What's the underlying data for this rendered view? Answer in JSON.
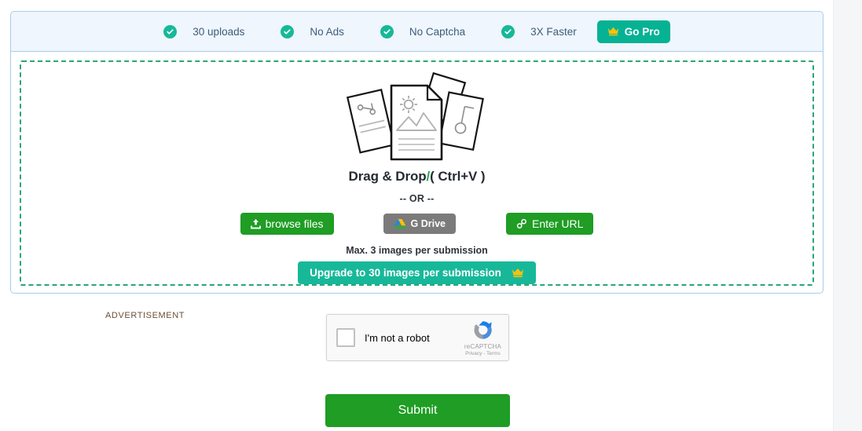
{
  "promo_banner": {
    "features": [
      {
        "icon": "check-circle-icon",
        "label": "30 uploads"
      },
      {
        "icon": "check-circle-icon",
        "label": "No Ads"
      },
      {
        "icon": "check-circle-icon",
        "label": "No Captcha"
      },
      {
        "icon": "check-circle-icon",
        "label": "3X Faster"
      }
    ],
    "go_pro_label": "Go Pro",
    "go_pro_icon": "crown-icon",
    "background_color": "#eff6fd",
    "border_color": "#a8cdec",
    "accent_color": "#06b294",
    "check_color": "#17b899",
    "crown_color": "#f2c310"
  },
  "dropzone": {
    "illustration_icon": "documents-stack-icon",
    "border_color": "#27a776",
    "drag_drop_main": "Drag & Drop",
    "drag_drop_separator": "/",
    "drag_drop_shortcut": "( Ctrl+V )",
    "or_text": "-- OR --",
    "buttons": {
      "browse_label": "browse files",
      "browse_icon": "upload-icon",
      "browse_color": "#1f9d24",
      "gdrive_label": "G Drive",
      "gdrive_icon": "google-drive-icon",
      "gdrive_color": "#7b7b7b",
      "url_label": "Enter URL",
      "url_icon": "link-icon",
      "url_color": "#1f9d24"
    },
    "max_note": "Max. 3 images per submission",
    "upgrade_label": "Upgrade to 30 images per submission",
    "upgrade_icon": "crown-icon",
    "upgrade_color": "#17b899"
  },
  "advertisement": {
    "label": "ADVERTISEMENT"
  },
  "recaptcha": {
    "checkbox_icon": "empty-checkbox-icon",
    "label": "I'm not a robot",
    "logo_icon": "recaptcha-logo-icon",
    "brand": "reCAPTCHA",
    "links": "Privacy - Terms"
  },
  "submit": {
    "label": "Submit",
    "color": "#1f9d24"
  }
}
